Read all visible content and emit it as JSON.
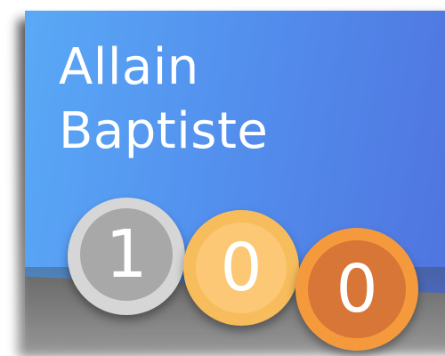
{
  "profile": {
    "first_name": "Allain",
    "last_name": "Baptiste"
  },
  "medals": {
    "silver": {
      "count": "1",
      "color": "#a8a8a8",
      "icon": "silver-medal-icon"
    },
    "gold": {
      "count": "0",
      "color": "#fcc875",
      "icon": "gold-medal-icon"
    },
    "bronze": {
      "count": "0",
      "color": "#d77636",
      "icon": "bronze-medal-icon"
    }
  },
  "colors": {
    "card_gradient_start": "#5aa9f6",
    "card_gradient_end": "#4f73de",
    "text": "#ffffff"
  }
}
